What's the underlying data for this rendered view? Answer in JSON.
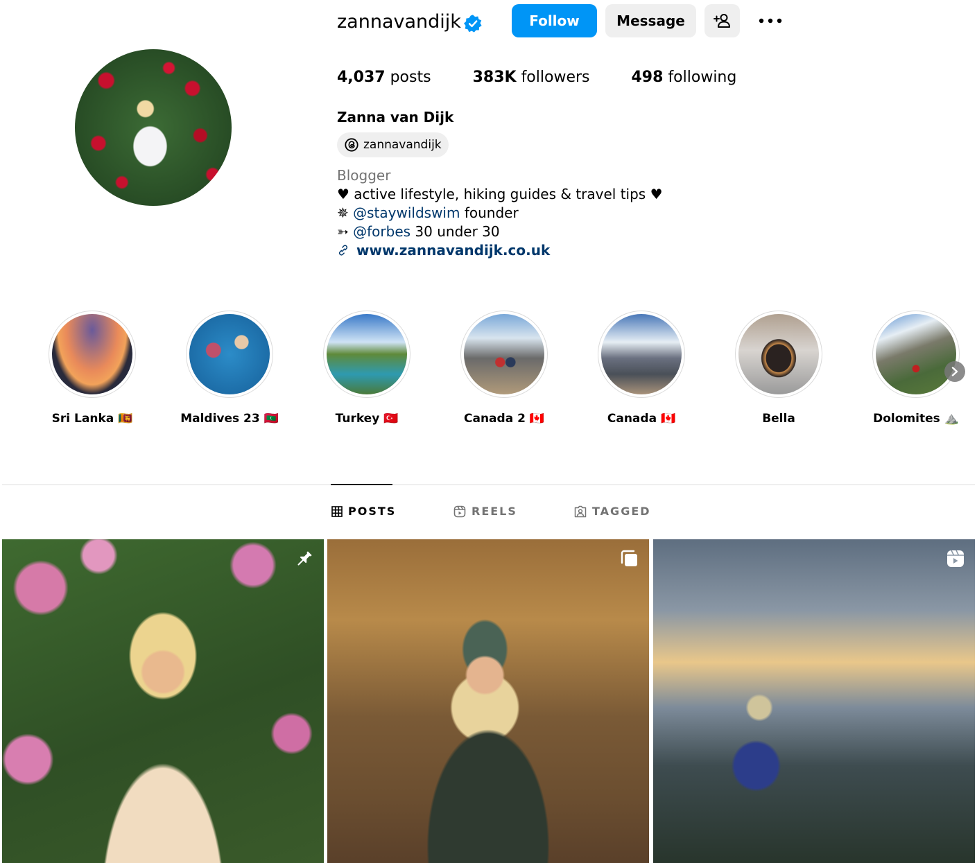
{
  "profile": {
    "username": "zannavandijk",
    "verified": true,
    "follow_label": "Follow",
    "message_label": "Message",
    "stats": {
      "posts_count": "4,037",
      "posts_label": "posts",
      "followers_count": "383K",
      "followers_label": "followers",
      "following_count": "498",
      "following_label": "following"
    },
    "full_name": "Zanna van Dijk",
    "threads_handle": "zannavandijk",
    "category": "Blogger",
    "bio": {
      "line1": "♥ active lifestyle, hiking guides & travel tips ♥",
      "line2_prefix": "✵ ",
      "line2_mention": "@staywildswim",
      "line2_suffix": " founder",
      "line3_prefix": "➳ ",
      "line3_mention": "@forbes",
      "line3_suffix": " 30 under 30"
    },
    "website": "www.zannavandijk.co.uk"
  },
  "highlights": [
    {
      "label": "Sri Lanka 🇱🇰"
    },
    {
      "label": "Maldives 23 🇲🇻"
    },
    {
      "label": "Turkey 🇹🇷"
    },
    {
      "label": "Canada 2 🇨🇦"
    },
    {
      "label": "Canada 🇨🇦"
    },
    {
      "label": "Bella"
    },
    {
      "label": "Dolomites ⛰️"
    }
  ],
  "tabs": {
    "posts": "POSTS",
    "reels": "REELS",
    "tagged": "TAGGED"
  },
  "posts": [
    {
      "type_icon": "pin-icon"
    },
    {
      "type_icon": "carousel-icon"
    },
    {
      "type_icon": "reel-icon"
    }
  ],
  "colors": {
    "accent": "#0095f6",
    "link": "#00376b",
    "secondary_text": "#737373",
    "button_bg": "#efefef",
    "divider": "#dbdbdb"
  }
}
